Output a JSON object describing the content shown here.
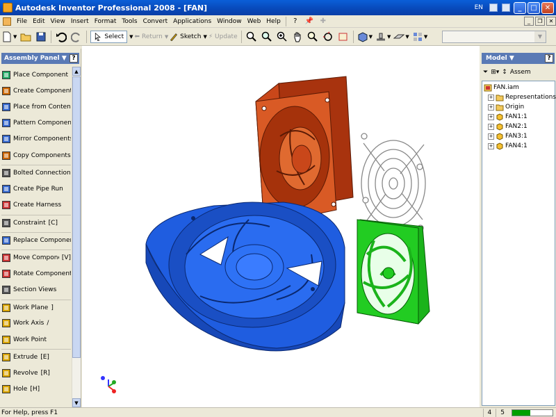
{
  "window": {
    "title": "Autodesk Inventor Professional 2008 - [FAN]",
    "language_indicator": "EN"
  },
  "menu": {
    "items": [
      "File",
      "Edit",
      "View",
      "Insert",
      "Format",
      "Tools",
      "Convert",
      "Applications",
      "Window",
      "Web",
      "Help"
    ]
  },
  "toolbar": {
    "select_label": "Select",
    "return_label": "Return",
    "sketch_label": "Sketch",
    "update_label": "Update"
  },
  "assembly_panel": {
    "title": "Assembly Panel",
    "commands": [
      {
        "label": "Place Component",
        "key": "",
        "icon": "place-component-icon",
        "color": "#2a6"
      },
      {
        "label": "Create Component",
        "key": "",
        "icon": "create-component-icon",
        "color": "#c60"
      },
      {
        "label": "Place from Content Center",
        "key": "",
        "icon": "content-center-icon",
        "color": "#36c"
      },
      {
        "label": "Pattern Component",
        "key": "",
        "icon": "pattern-component-icon",
        "color": "#36c"
      },
      {
        "label": "Mirror Components",
        "key": "",
        "icon": "mirror-components-icon",
        "color": "#36c"
      },
      {
        "label": "Copy Components",
        "key": "",
        "icon": "copy-components-icon",
        "color": "#c60"
      },
      {
        "label": "Bolted Connection",
        "key": "",
        "icon": "bolted-connection-icon",
        "color": "#555"
      },
      {
        "label": "Create Pipe Run",
        "key": "",
        "icon": "create-pipe-run-icon",
        "color": "#36c"
      },
      {
        "label": "Create Harness",
        "key": "",
        "icon": "create-harness-icon",
        "color": "#c33"
      },
      {
        "label": "Constraint",
        "key": "[C]",
        "icon": "constraint-icon",
        "color": "#555"
      },
      {
        "label": "Replace Component",
        "key": "",
        "icon": "replace-component-icon",
        "color": "#36c"
      },
      {
        "label": "Move Component",
        "key": "[V]",
        "icon": "move-component-icon",
        "color": "#c33"
      },
      {
        "label": "Rotate Component",
        "key": "",
        "icon": "rotate-component-icon",
        "color": "#c33"
      },
      {
        "label": "Section Views",
        "key": "",
        "icon": "section-views-icon",
        "color": "#555"
      },
      {
        "label": "Work Plane",
        "key": "]",
        "icon": "work-plane-icon",
        "color": "#d9a400"
      },
      {
        "label": "Work Axis",
        "key": "/",
        "icon": "work-axis-icon",
        "color": "#d9a400"
      },
      {
        "label": "Work Point",
        "key": "",
        "icon": "work-point-icon",
        "color": "#d9a400"
      },
      {
        "label": "Extrude",
        "key": "[E]",
        "icon": "extrude-icon",
        "color": "#d9a400"
      },
      {
        "label": "Revolve",
        "key": "[R]",
        "icon": "revolve-icon",
        "color": "#d9a400"
      },
      {
        "label": "Hole",
        "key": "[H]",
        "icon": "hole-icon",
        "color": "#d9a400"
      }
    ]
  },
  "browser": {
    "title": "Model",
    "tool_label": "Assem",
    "root": "FAN.iam",
    "items": [
      {
        "label": "Representations",
        "expandable": true,
        "icon": "folder-icon"
      },
      {
        "label": "Origin",
        "expandable": true,
        "icon": "folder-icon"
      },
      {
        "label": "FAN1:1",
        "expandable": true,
        "icon": "part-icon"
      },
      {
        "label": "FAN2:1",
        "expandable": true,
        "icon": "part-icon"
      },
      {
        "label": "FAN3:1",
        "expandable": true,
        "icon": "part-icon"
      },
      {
        "label": "FAN4:1",
        "expandable": true,
        "icon": "part-icon"
      }
    ]
  },
  "status": {
    "help_text": "For Help, press F1",
    "value_1": "4",
    "value_2": "5",
    "progress": 0.45
  },
  "colors": {
    "fan_red": "#d14a1a",
    "fan_blue": "#1f5de0",
    "fan_green": "#22cc22",
    "grille_gray": "#888888"
  }
}
